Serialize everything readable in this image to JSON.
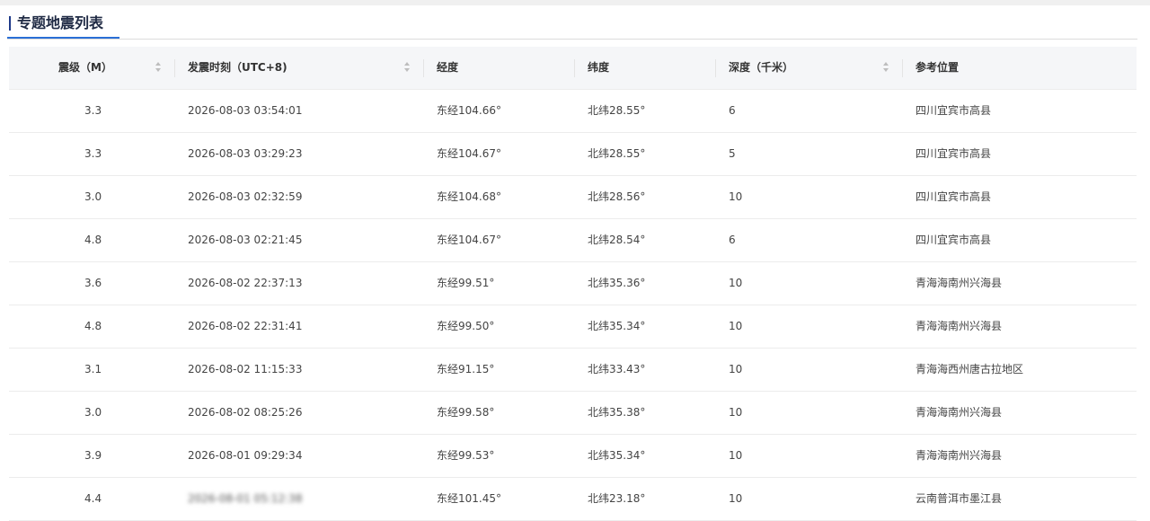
{
  "section": {
    "title": "专题地震列表"
  },
  "table": {
    "headers": {
      "magnitude": "震级（M）",
      "time": "发震时刻（UTC+8)",
      "longitude": "经度",
      "latitude": "纬度",
      "depth": "深度（千米）",
      "location": "参考位置"
    },
    "rows": [
      {
        "magnitude": "3.3",
        "time": "2026-08-03 03:54:01",
        "longitude": "东经104.66°",
        "latitude": "北纬28.55°",
        "depth": "6",
        "location": "四川宜宾市高县"
      },
      {
        "magnitude": "3.3",
        "time": "2026-08-03 03:29:23",
        "longitude": "东经104.67°",
        "latitude": "北纬28.55°",
        "depth": "5",
        "location": "四川宜宾市高县"
      },
      {
        "magnitude": "3.0",
        "time": "2026-08-03 02:32:59",
        "longitude": "东经104.68°",
        "latitude": "北纬28.56°",
        "depth": "10",
        "location": "四川宜宾市高县"
      },
      {
        "magnitude": "4.8",
        "time": "2026-08-03 02:21:45",
        "longitude": "东经104.67°",
        "latitude": "北纬28.54°",
        "depth": "6",
        "location": "四川宜宾市高县"
      },
      {
        "magnitude": "3.6",
        "time": "2026-08-02 22:37:13",
        "longitude": "东经99.51°",
        "latitude": "北纬35.36°",
        "depth": "10",
        "location": "青海海南州兴海县"
      },
      {
        "magnitude": "4.8",
        "time": "2026-08-02 22:31:41",
        "longitude": "东经99.50°",
        "latitude": "北纬35.34°",
        "depth": "10",
        "location": "青海海南州兴海县"
      },
      {
        "magnitude": "3.1",
        "time": "2026-08-02 11:15:33",
        "longitude": "东经91.15°",
        "latitude": "北纬33.43°",
        "depth": "10",
        "location": "青海海西州唐古拉地区"
      },
      {
        "magnitude": "3.0",
        "time": "2026-08-02 08:25:26",
        "longitude": "东经99.58°",
        "latitude": "北纬35.38°",
        "depth": "10",
        "location": "青海海南州兴海县"
      },
      {
        "magnitude": "3.9",
        "time": "2026-08-01 09:29:34",
        "longitude": "东经99.53°",
        "latitude": "北纬35.34°",
        "depth": "10",
        "location": "青海海南州兴海县"
      },
      {
        "magnitude": "4.4",
        "time": "2026-08-01 05:12:38",
        "longitude": "东经101.45°",
        "latitude": "北纬23.18°",
        "depth": "10",
        "location": "云南普洱市墨江县"
      }
    ]
  }
}
